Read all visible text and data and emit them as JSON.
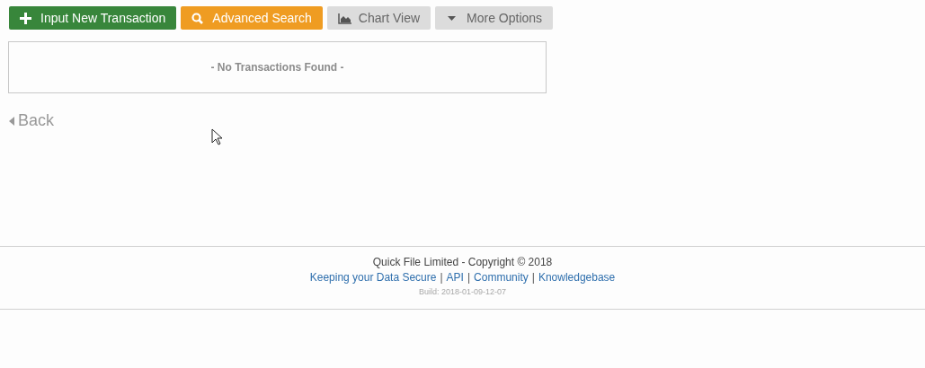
{
  "toolbar": [
    {
      "kind": "add",
      "label": "Input New Transaction"
    },
    {
      "kind": "search",
      "label": "Advanced Search"
    },
    {
      "kind": "chart",
      "label": "Chart View"
    },
    {
      "kind": "dropdown",
      "label": "More Options"
    }
  ],
  "transactions": {
    "empty_message": "- No Transactions Found -"
  },
  "back_link": "Back",
  "footer": {
    "copyright": "Quick File Limited - Copyright © 2018",
    "links": [
      "Keeping your Data Secure",
      "API",
      "Community",
      "Knowledgebase"
    ],
    "separator": "|",
    "build": "Build: 2018-01-09-12-07"
  }
}
